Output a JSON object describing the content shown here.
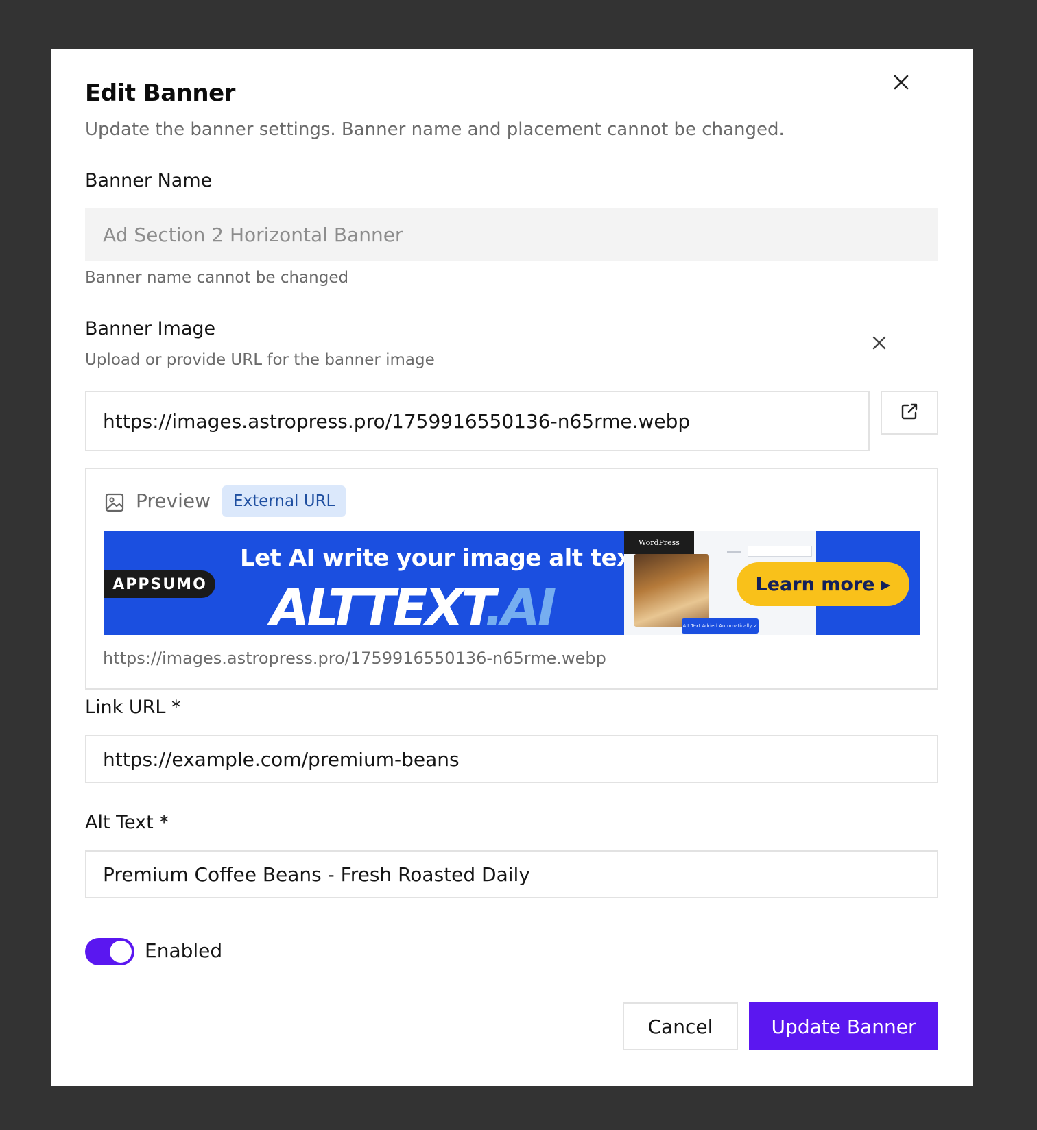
{
  "dialog": {
    "title": "Edit Banner",
    "subtitle": "Update the banner settings. Banner name and placement cannot be changed."
  },
  "banner_name": {
    "label": "Banner Name",
    "value": "Ad Section 2 Horizontal Banner",
    "hint": "Banner name cannot be changed"
  },
  "banner_image": {
    "label": "Banner Image",
    "hint": "Upload or provide URL for the banner image",
    "url_value": "https://images.astropress.pro/1759916550136-n65rme.webp",
    "preview_label": "Preview",
    "preview_badge": "External URL",
    "preview_url": "https://images.astropress.pro/1759916550136-n65rme.webp",
    "ad": {
      "brand_tag": "APPSUMO",
      "headline": "Let AI write your image alt text",
      "product_main": "ALTTEXT",
      "product_suffix": ".AI",
      "platform": "WordPress",
      "cta": "Learn more ▸",
      "tag": "Alt Text Added Automatically ✓"
    }
  },
  "link_url": {
    "label": "Link URL *",
    "value": "https://example.com/premium-beans"
  },
  "alt_text": {
    "label": "Alt Text *",
    "value": "Premium Coffee Beans - Fresh Roasted Daily"
  },
  "status": {
    "label": "Enabled",
    "enabled": true
  },
  "actions": {
    "cancel": "Cancel",
    "submit": "Update Banner"
  },
  "colors": {
    "overlay": "#333333",
    "accent": "#5b17f0",
    "badge_bg": "#dbe8fb",
    "badge_text": "#1f4fa0"
  }
}
